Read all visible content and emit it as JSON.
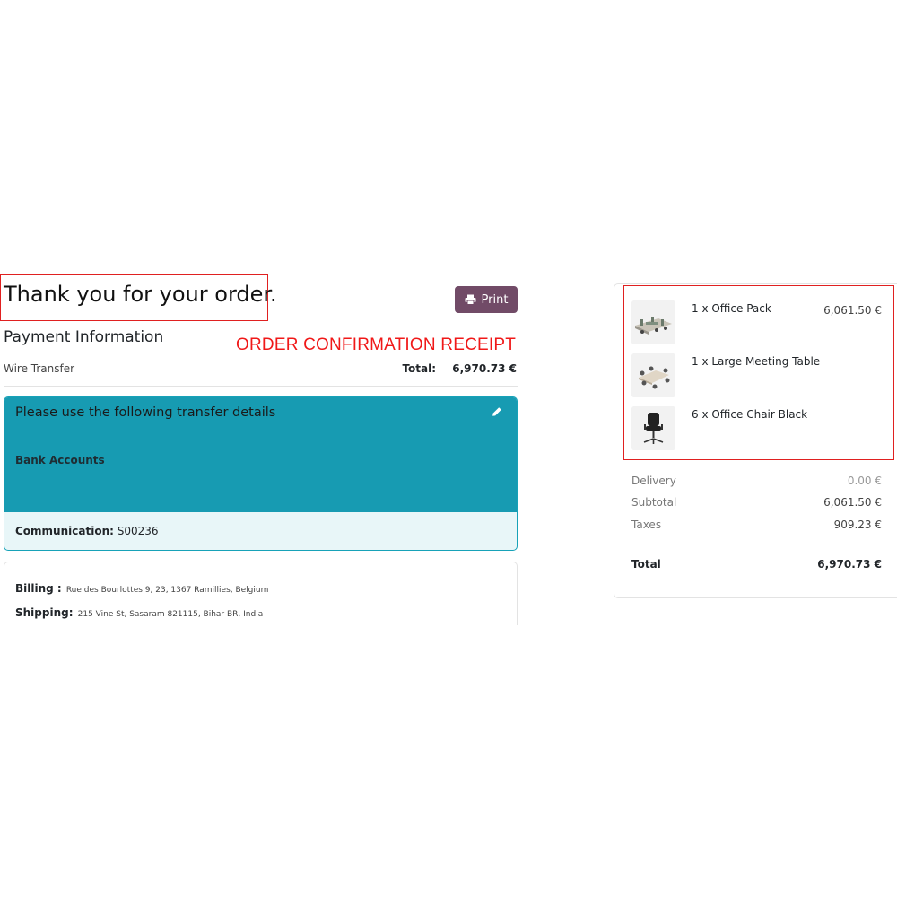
{
  "header": {
    "title": "Thank you for your order.",
    "print_label": "Print"
  },
  "annotation": "ORDER CONFIRMATION RECEIPT",
  "payment": {
    "heading": "Payment Information",
    "method": "Wire Transfer",
    "total_label": "Total:",
    "total_value": "6,970.73 €"
  },
  "transfer": {
    "title": "Please use the following transfer details",
    "bank_label": "Bank Accounts",
    "communication_label": "Communication:",
    "communication_value": "S00236"
  },
  "address": {
    "billing_label": "Billing :",
    "billing_value": "Rue des Bourlottes 9, 23, 1367 Ramillies, Belgium",
    "shipping_label": "Shipping:",
    "shipping_value": "215 Vine St, Sasaram 821115, Bihar BR, India"
  },
  "summary": {
    "items": [
      {
        "name": "1 x Office Pack",
        "price": "6,061.50 €",
        "thumb": "office-pack-image"
      },
      {
        "name": "1 x Large Meeting Table",
        "price": "",
        "thumb": "meeting-table-image"
      },
      {
        "name": "6 x Office Chair Black",
        "price": "",
        "thumb": "office-chair-image"
      }
    ],
    "delivery_label": "Delivery",
    "delivery_value": "0.00 €",
    "subtotal_label": "Subtotal",
    "subtotal_value": "6,061.50 €",
    "taxes_label": "Taxes",
    "taxes_value": "909.23 €",
    "total_label": "Total",
    "total_value": "6,970.73 €"
  },
  "colors": {
    "brand": "#714b67",
    "info": "#179bb2",
    "annotation": "#e02020"
  }
}
